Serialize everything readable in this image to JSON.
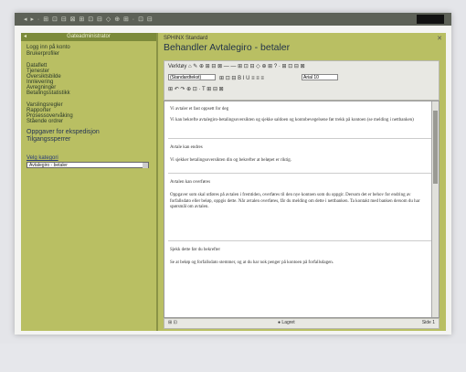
{
  "window": {
    "topbar_icons": "◂ ▸ · ⊞ ⊡ ⊟ ⊠ ⊞ ⊡ ⊟ ◇ ⊕ ⊞ · ⊡ ⊟"
  },
  "sidebar": {
    "header": "Gateadministrator",
    "links": [
      "Logg inn på konto",
      "Brukerprofiler",
      "Dataflett",
      "Tjenester",
      "Oversiktsbilde",
      "Innlevering",
      "Avregninger",
      "Betalingsstatistikk",
      "Varslingsregler",
      "Rapporter",
      "Prosessovervåking",
      "Stående ordrer",
      "Oppgaver for ekspedisjon",
      "Tilgangssperrer"
    ],
    "big_links": [
      "Oppgaver for ekspedisjon",
      "Tilgangssperrer"
    ],
    "select_label": "Velg kategori",
    "select_value": "Avtalegiro - betaler"
  },
  "main": {
    "small": "SPHINX Standard",
    "title": "Behandler Avtalegiro - betaler",
    "toolbar": {
      "row1": "Verktøy    ⌂  ✎  ⊕  ⊞  ⊟  ⊠  —  —  ⊞  ⊡  ⊟  ◇  ⊕  ⊞  ?  ·  ⊞  ⊡  ⊟  ⊠",
      "row2_select": "(Standardtekst)",
      "row2_input": "Arial 10",
      "row2_rest": "⊞  ⊡  ⊟  B  I  U  ≡  ≡  ≡",
      "row3": "⊞  ↶  ↷  ⊕  ⊡  ·  T  ⊞  ⊟  ⊠"
    },
    "editor": {
      "p1": "Vi avtaler et fast oppsett for deg",
      "p2": "Vi kan bekrefte avtalegiro-betalingsoversikten og sjekke saldoen og kontobevegelsene før trekk på kontoen (se melding i nettbanken)",
      "h2": "Avtale kan endres",
      "p3": "Vi sjekker betalingsoversikten din og bekrefter at beløpet er riktig.",
      "h3": "Avtalen kan overføres",
      "p4": "Oppgaver som skal utføres på avtalen i fremtiden, overføres til den nye kontoen som du oppgir. Dersom det er behov for endring av forfallsdato eller beløp, oppgis dette. Når avtalen overføres, får du melding om dette i nettbanken. Ta kontakt med banken dersom du har spørsmål om avtalen.",
      "h4": "Sjekk dette før du bekrefter",
      "p5": "Se at beløp og forfallsdato stemmer, og at du har nok penger på kontoen på forfallsdagen."
    },
    "status": {
      "left": "⊞ ⊡",
      "center": "● Lagret",
      "right": "Side 1"
    }
  }
}
